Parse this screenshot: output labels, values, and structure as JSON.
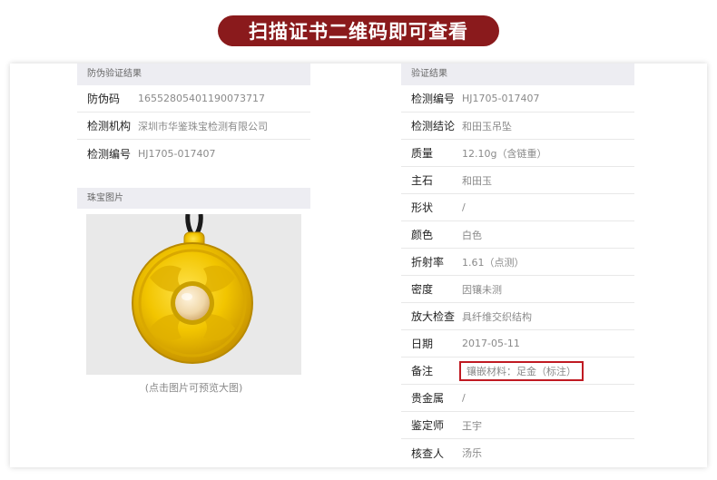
{
  "banner": {
    "title": "扫描证书二维码即可查看"
  },
  "left": {
    "section_title": "防伪验证结果",
    "rows": [
      {
        "label": "防伪码",
        "value": "16552805401190073717"
      },
      {
        "label": "检测机构",
        "value": "深圳市华鉴珠宝检测有限公司"
      },
      {
        "label": "检测编号",
        "value": "HJ1705-017407"
      }
    ],
    "photo_section_title": "珠宝图片",
    "photo_caption": "(点击图片可预览大图)",
    "photo_icon": "gold-jade-pendant"
  },
  "right": {
    "section_title": "验证结果",
    "rows": [
      {
        "label": "检测编号",
        "value": "HJ1705-017407"
      },
      {
        "label": "检测结论",
        "value": "和田玉吊坠"
      },
      {
        "label": "质量",
        "value": "12.10g（含链重）"
      },
      {
        "label": "主石",
        "value": "和田玉"
      },
      {
        "label": "形状",
        "value": "/"
      },
      {
        "label": "颜色",
        "value": "白色"
      },
      {
        "label": "折射率",
        "value": "1.61（点测）"
      },
      {
        "label": "密度",
        "value": "因镶未测"
      },
      {
        "label": "放大检查",
        "value": "具纤维交织结构"
      },
      {
        "label": "日期",
        "value": "2017-05-11"
      },
      {
        "label": "备注",
        "value": "镶嵌材料：足金（标注）"
      },
      {
        "label": "贵金属",
        "value": "/"
      },
      {
        "label": "鉴定师",
        "value": "王宇"
      },
      {
        "label": "核查人",
        "value": "汤乐"
      }
    ]
  },
  "colors": {
    "banner_bg": "#8a1a1c",
    "highlight": "#c01a22",
    "header_bg": "#ededf2"
  }
}
